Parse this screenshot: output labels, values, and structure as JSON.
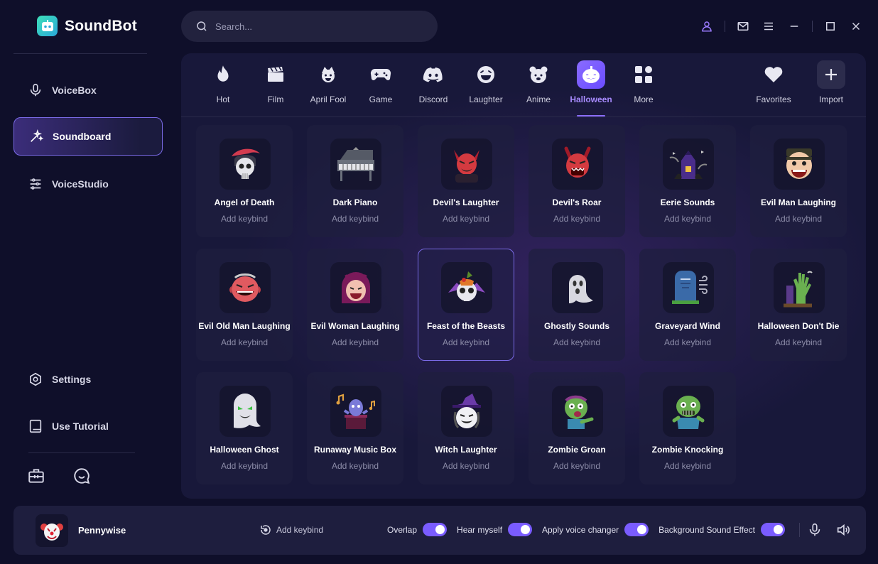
{
  "app": {
    "name": "SoundBot",
    "accent": "#8a6cff"
  },
  "sidebar": {
    "items": [
      {
        "label": "VoiceBox",
        "icon": "microphone-icon"
      },
      {
        "label": "Soundboard",
        "icon": "magic-wand-icon",
        "active": true
      },
      {
        "label": "VoiceStudio",
        "icon": "sliders-icon"
      }
    ],
    "bottom_items": [
      {
        "label": "Settings",
        "icon": "gear-icon"
      },
      {
        "label": "Use Tutorial",
        "icon": "book-icon"
      }
    ]
  },
  "search": {
    "placeholder": "Search..."
  },
  "tabs": [
    {
      "label": "Hot",
      "icon": "flame-icon"
    },
    {
      "label": "Film",
      "icon": "clapperboard-icon"
    },
    {
      "label": "April Fool",
      "icon": "jester-icon"
    },
    {
      "label": "Game",
      "icon": "gamepad-icon"
    },
    {
      "label": "Discord",
      "icon": "discord-icon"
    },
    {
      "label": "Laughter",
      "icon": "laughing-face-icon"
    },
    {
      "label": "Anime",
      "icon": "bear-icon"
    },
    {
      "label": "Halloween",
      "icon": "pumpkin-icon",
      "active": true
    },
    {
      "label": "More",
      "icon": "grid-icon"
    }
  ],
  "right_tabs": [
    {
      "label": "Favorites",
      "icon": "heart-icon"
    },
    {
      "label": "Import",
      "icon": "plus-icon"
    }
  ],
  "sounds": [
    {
      "name": "Angel of Death",
      "keybind": "Add keybind"
    },
    {
      "name": "Dark Piano",
      "keybind": "Add keybind"
    },
    {
      "name": "Devil's Laughter",
      "keybind": "Add keybind"
    },
    {
      "name": "Devil's Roar",
      "keybind": "Add keybind"
    },
    {
      "name": "Eerie Sounds",
      "keybind": "Add keybind"
    },
    {
      "name": "Evil Man Laughing",
      "keybind": "Add keybind"
    },
    {
      "name": "Evil Old Man Laughing",
      "keybind": "Add keybind"
    },
    {
      "name": "Evil Woman Laughing",
      "keybind": "Add keybind"
    },
    {
      "name": "Feast of the Beasts",
      "keybind": "Add keybind",
      "selected": true
    },
    {
      "name": "Ghostly Sounds",
      "keybind": "Add keybind"
    },
    {
      "name": "Graveyard Wind",
      "keybind": "Add keybind"
    },
    {
      "name": "Halloween Don't Die",
      "keybind": "Add keybind"
    },
    {
      "name": "Halloween Ghost",
      "keybind": "Add keybind"
    },
    {
      "name": "Runaway Music Box",
      "keybind": "Add keybind"
    },
    {
      "name": "Witch Laughter",
      "keybind": "Add keybind"
    },
    {
      "name": "Zombie Groan",
      "keybind": "Add keybind"
    },
    {
      "name": "Zombie Knocking",
      "keybind": "Add keybind"
    }
  ],
  "bottom_bar": {
    "voice_name": "Pennywise",
    "keybind_label": "Add keybind",
    "toggles": [
      {
        "label": "Overlap",
        "on": true
      },
      {
        "label": "Hear myself",
        "on": true
      },
      {
        "label": "Apply voice changer",
        "on": true
      },
      {
        "label": "Background Sound Effect",
        "on": true
      }
    ]
  }
}
